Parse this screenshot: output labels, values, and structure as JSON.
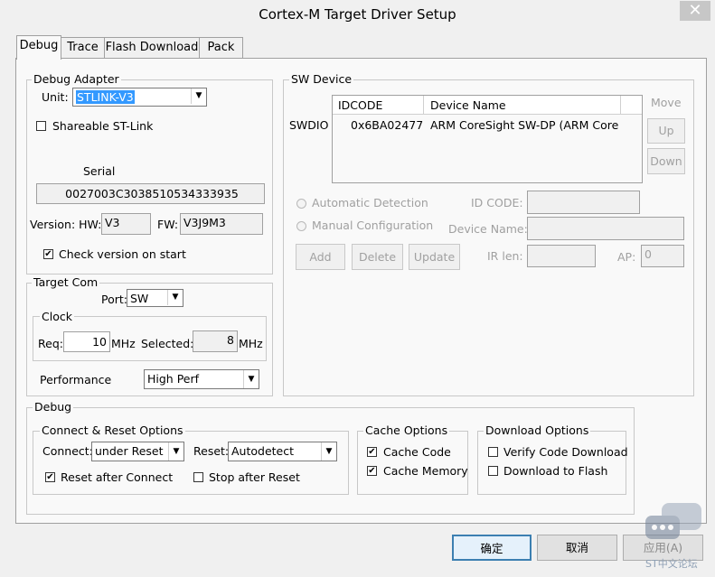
{
  "window": {
    "title": "Cortex-M Target Driver Setup"
  },
  "tabs": [
    {
      "label": "Debug"
    },
    {
      "label": "Trace"
    },
    {
      "label": "Flash Download"
    },
    {
      "label": "Pack"
    }
  ],
  "debug_adapter": {
    "title": "Debug Adapter",
    "unit_label": "Unit:",
    "unit_value": "STLINK-V3",
    "shareable_label": "Shareable ST-Link",
    "serial_label": "Serial",
    "serial_value": "0027003C3038510534333935",
    "version_hw_label": "Version: HW:",
    "hw_value": "V3",
    "fw_label": "FW:",
    "fw_value": "V3J9M3",
    "check_version_label": "Check version on start"
  },
  "target_com": {
    "title": "Target Com",
    "port_label": "Port:",
    "port_value": "SW",
    "clock_title": "Clock",
    "req_label": "Req:",
    "req_value": "10",
    "req_unit": "MHz",
    "selected_label": "Selected:",
    "selected_value": "8",
    "selected_unit": "MHz",
    "performance_label": "Performance",
    "performance_value": "High Perf"
  },
  "sw_device": {
    "title": "SW Device",
    "swdio_label": "SWDIO",
    "col_idcode": "IDCODE",
    "col_device_name": "Device Name",
    "row_idcode": "0x6BA02477",
    "row_device_name": "ARM CoreSight SW-DP (ARM Core",
    "move_label": "Move",
    "up_button": "Up",
    "down_button": "Down",
    "auto_detection": "Automatic Detection",
    "manual_config": "Manual Configuration",
    "id_code_label": "ID CODE:",
    "device_name_label": "Device Name:",
    "add_button": "Add",
    "delete_button": "Delete",
    "update_button": "Update",
    "ir_len_label": "IR len:",
    "ap_label": "AP:",
    "ap_value": "0"
  },
  "debug_section": {
    "title": "Debug",
    "connect_reset_title": "Connect & Reset Options",
    "connect_label": "Connect:",
    "connect_value": "under Reset",
    "reset_label": "Reset:",
    "reset_value": "Autodetect",
    "reset_after_connect": "Reset after Connect",
    "stop_after_reset": "Stop after Reset",
    "cache_title": "Cache Options",
    "cache_code": "Cache Code",
    "cache_memory": "Cache Memory",
    "download_title": "Download Options",
    "verify_code": "Verify Code Download",
    "download_flash": "Download to Flash"
  },
  "footer": {
    "ok_button": "确定",
    "cancel_button": "取消",
    "apply_button": "应用(A)",
    "watermark": "ST中文论坛"
  }
}
